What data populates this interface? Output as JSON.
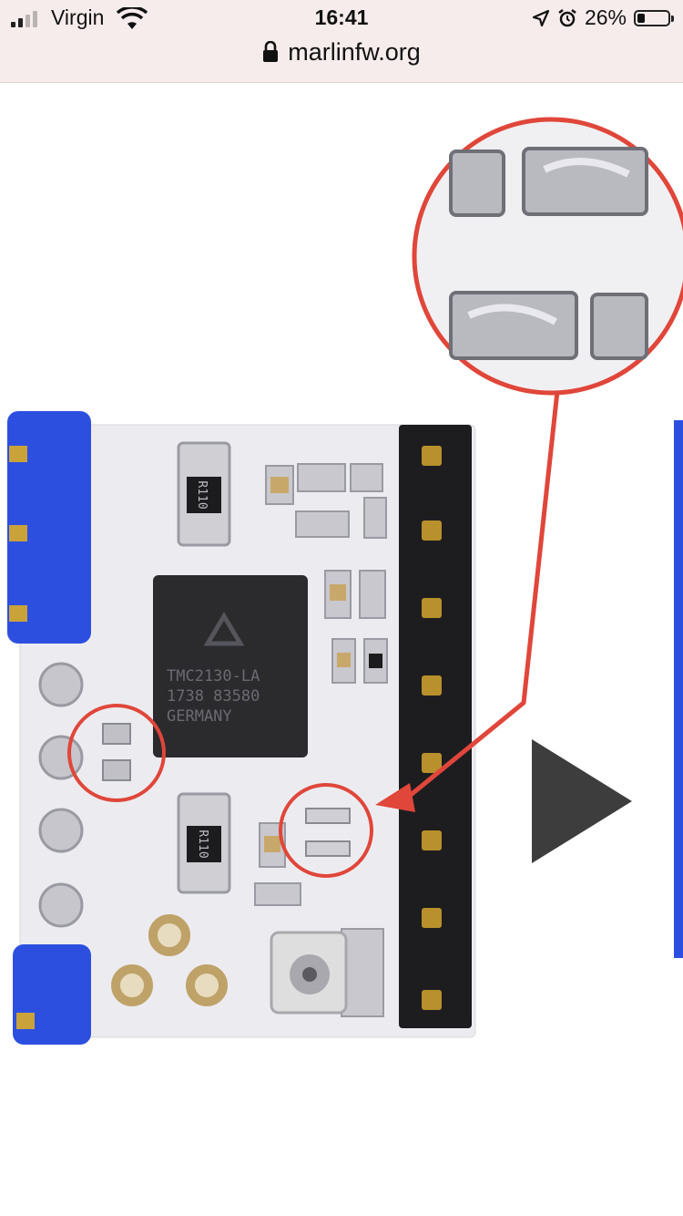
{
  "status_bar": {
    "carrier": "Virgin",
    "time": "16:41",
    "battery_percent": "26%",
    "battery_level": 0.26,
    "icons": [
      "signal-icon",
      "wifi-icon",
      "location-icon",
      "alarm-icon",
      "battery-icon"
    ]
  },
  "browser": {
    "url": "marlinfw.org",
    "lock_icon": "lock-icon"
  },
  "content": {
    "chip_line1": "TMC2130-LA",
    "chip_line2": "1738 83580",
    "chip_line3": "GERMANY",
    "resistor_label": "R110",
    "navigation_icon": "play-arrow-icon",
    "colors": {
      "highlight_circle": "#e0463a",
      "pcb": "#ececf0",
      "chip": "#2b2b2e",
      "header_blue": "#2d4fe0",
      "arrow": "#3d3d3d"
    }
  }
}
